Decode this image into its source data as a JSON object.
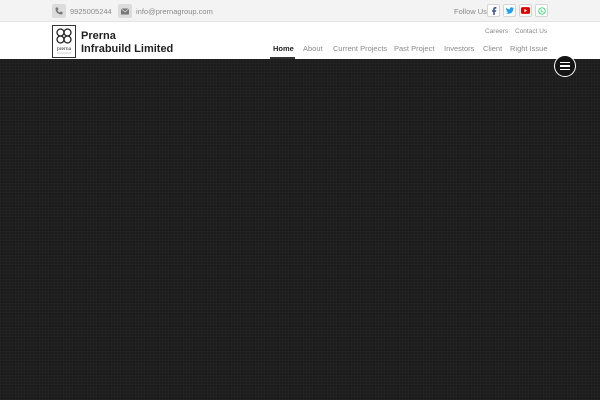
{
  "topbar": {
    "phone": {
      "icon": "phone-icon",
      "text": "9925005244"
    },
    "email": {
      "icon": "mail-icon",
      "text": "info@prernagroup.com"
    },
    "follow_label": "Follow Us",
    "social": [
      {
        "icon": "facebook-icon",
        "color": "#3b5998"
      },
      {
        "icon": "twitter-icon",
        "color": "#1da1f2"
      },
      {
        "icon": "youtube-icon",
        "color": "#e00000"
      },
      {
        "icon": "whatsapp-icon",
        "color": "#25d366"
      }
    ]
  },
  "header": {
    "logo": {
      "text": "prerna"
    },
    "brand_line1": "Prerna",
    "brand_line2": "Infrabuild Limited",
    "utility_links": [
      "Careers",
      "Contact Us"
    ],
    "nav": [
      {
        "label": "Home",
        "active": true
      },
      {
        "label": "About"
      },
      {
        "label": "Current Projects"
      },
      {
        "label": "Past Project"
      },
      {
        "label": "Investors"
      },
      {
        "label": "Client"
      },
      {
        "label": "Right Issue"
      }
    ]
  },
  "hero": {
    "menu_icon": "hamburger-icon",
    "background": "#1c1c1c"
  }
}
